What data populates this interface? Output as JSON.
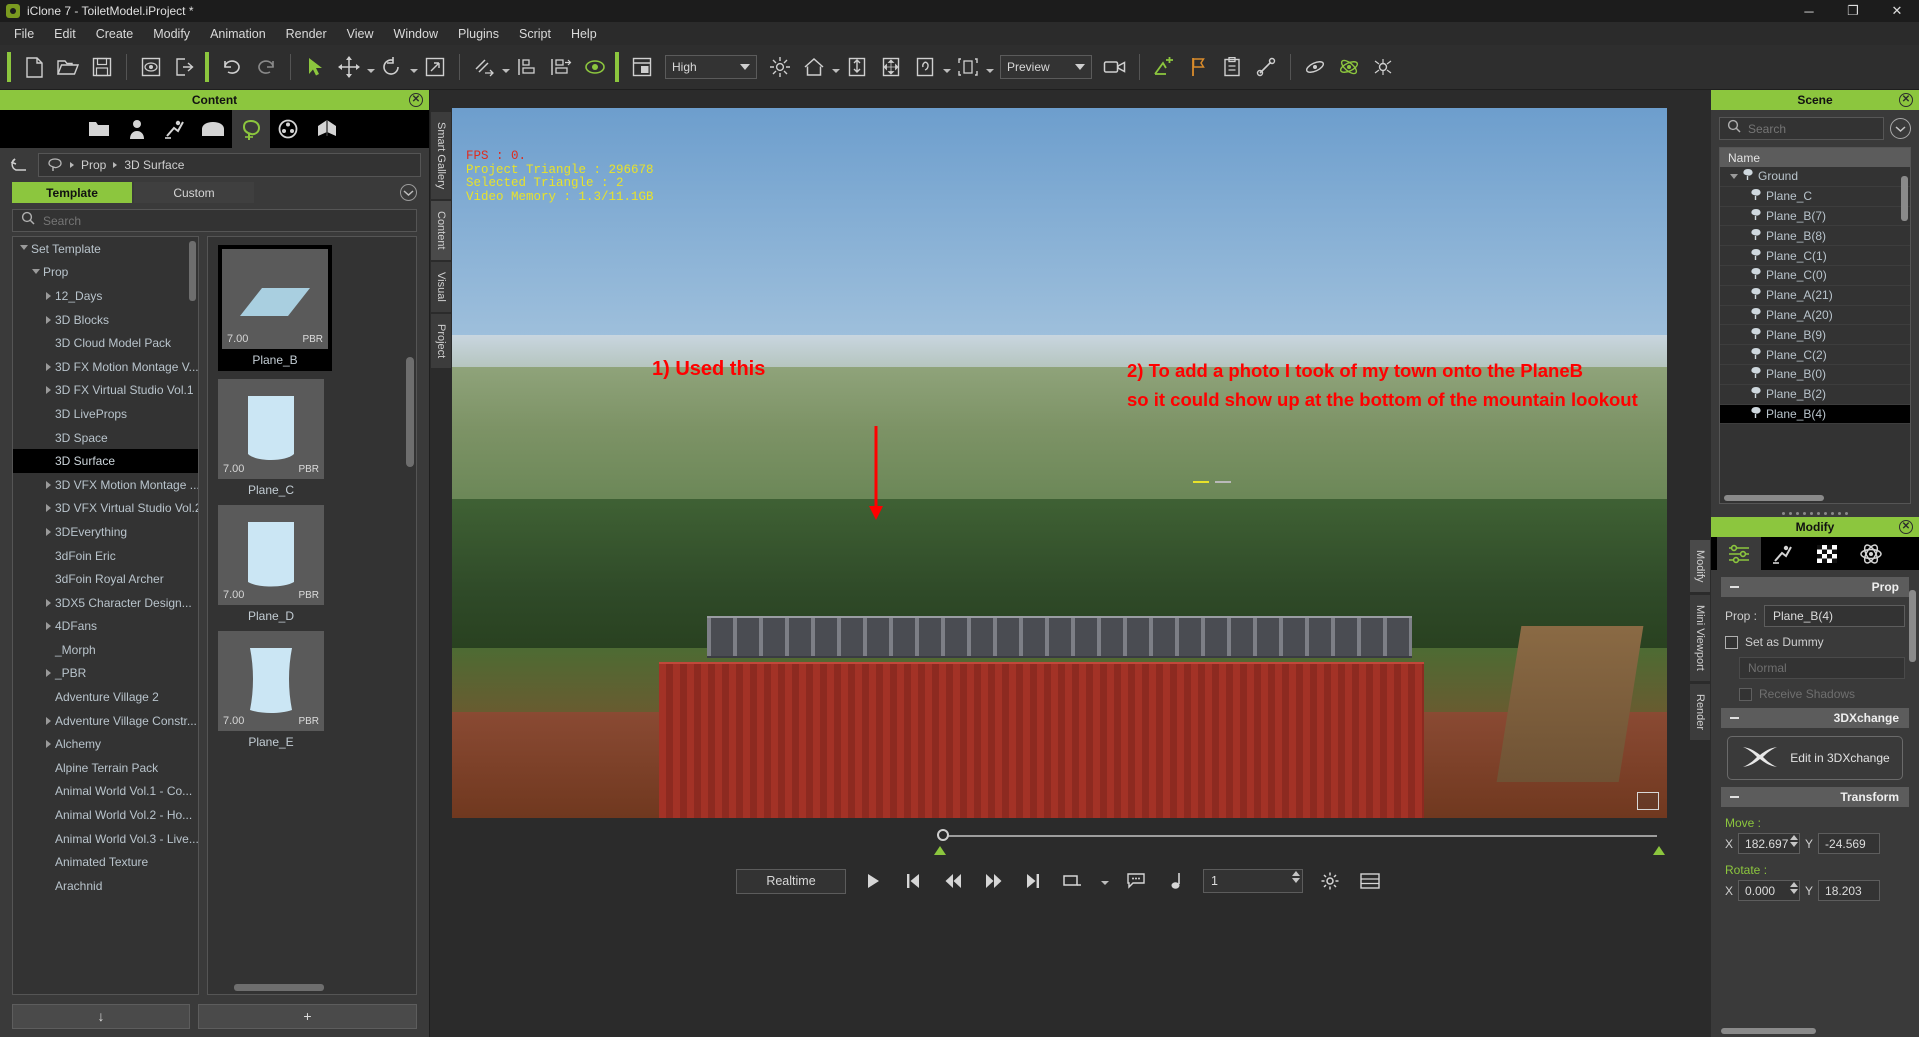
{
  "window": {
    "title": "iClone 7 - ToiletModel.iProject *",
    "minimize": "─",
    "maximize": "❐",
    "close": "✕"
  },
  "menubar": {
    "items": [
      "File",
      "Edit",
      "Create",
      "Modify",
      "Animation",
      "Render",
      "View",
      "Window",
      "Plugins",
      "Script",
      "Help"
    ]
  },
  "toolbar": {
    "quality_value": "High",
    "preview_value": "Preview",
    "icons": [
      "new-icon",
      "open-icon",
      "save-icon",
      "preview-window-icon",
      "export-icon",
      "undo-icon",
      "redo-icon",
      "select-arrow-icon",
      "move-icon",
      "rotate-icon",
      "scale-icon",
      "link-icon",
      "align-icon",
      "align-distribute-icon",
      "eye-icon",
      "layout-icon",
      "light-icon",
      "home-icon",
      "ground-icon",
      "center-icon",
      "camera-view-icon",
      "bounding-box-icon",
      "camera-icon",
      "light-add-icon",
      "flag-icon",
      "clipboard-icon",
      "magnet-icon",
      "physics-icon",
      "particle-icon",
      "spider-icon"
    ]
  },
  "content_panel": {
    "title": "Content",
    "library_tabs": [
      "folder-icon",
      "character-icon",
      "motion-icon",
      "stage-icon",
      "prop-icon",
      "media-icon",
      "element-icon"
    ],
    "breadcrumb": {
      "root_icon": "library-icon",
      "items": [
        "Prop",
        "3D Surface"
      ]
    },
    "tabs": [
      {
        "label": "Template",
        "active": true
      },
      {
        "label": "Custom",
        "active": false
      }
    ],
    "search_placeholder": "Search",
    "search_value": "",
    "tree": [
      {
        "label": "Set Template",
        "depth": 0,
        "state": "open"
      },
      {
        "label": "Prop",
        "depth": 1,
        "state": "open"
      },
      {
        "label": "12_Days",
        "depth": 2,
        "state": "closed"
      },
      {
        "label": "3D Blocks",
        "depth": 2,
        "state": "closed"
      },
      {
        "label": "3D Cloud Model Pack",
        "depth": 2,
        "state": "leaf"
      },
      {
        "label": "3D FX Motion Montage V...",
        "depth": 2,
        "state": "closed"
      },
      {
        "label": "3D FX Virtual Studio Vol.1",
        "depth": 2,
        "state": "closed"
      },
      {
        "label": "3D LiveProps",
        "depth": 2,
        "state": "leaf"
      },
      {
        "label": "3D Space",
        "depth": 2,
        "state": "leaf"
      },
      {
        "label": "3D Surface",
        "depth": 2,
        "state": "leaf",
        "selected": true
      },
      {
        "label": "3D VFX Motion Montage ...",
        "depth": 2,
        "state": "closed"
      },
      {
        "label": "3D VFX Virtual Studio Vol.2",
        "depth": 2,
        "state": "closed"
      },
      {
        "label": "3DEverything",
        "depth": 2,
        "state": "closed"
      },
      {
        "label": "3dFoin Eric",
        "depth": 2,
        "state": "leaf"
      },
      {
        "label": "3dFoin Royal Archer",
        "depth": 2,
        "state": "leaf"
      },
      {
        "label": "3DX5 Character Design...",
        "depth": 2,
        "state": "closed"
      },
      {
        "label": "4DFans",
        "depth": 2,
        "state": "closed"
      },
      {
        "label": "_Morph",
        "depth": 2,
        "state": "leaf"
      },
      {
        "label": "_PBR",
        "depth": 2,
        "state": "closed"
      },
      {
        "label": "Adventure Village 2",
        "depth": 2,
        "state": "leaf"
      },
      {
        "label": "Adventure Village Constr...",
        "depth": 2,
        "state": "closed"
      },
      {
        "label": "Alchemy",
        "depth": 2,
        "state": "closed"
      },
      {
        "label": "Alpine Terrain Pack",
        "depth": 2,
        "state": "leaf"
      },
      {
        "label": "Animal World Vol.1 - Co...",
        "depth": 2,
        "state": "leaf"
      },
      {
        "label": "Animal World Vol.2 - Ho...",
        "depth": 2,
        "state": "leaf"
      },
      {
        "label": "Animal World Vol.3 - Live...",
        "depth": 2,
        "state": "leaf"
      },
      {
        "label": "Animated Texture",
        "depth": 2,
        "state": "leaf"
      },
      {
        "label": "Arachnid",
        "depth": 2,
        "state": "leaf"
      }
    ],
    "thumbnails": [
      {
        "name": "Plane_B",
        "duration": "7.00",
        "badge": "PBR",
        "selected": true,
        "shape": "flat"
      },
      {
        "name": "Plane_C",
        "duration": "7.00",
        "badge": "PBR",
        "selected": false,
        "shape": "curve1"
      },
      {
        "name": "Plane_D",
        "duration": "7.00",
        "badge": "PBR",
        "selected": false,
        "shape": "curve2"
      },
      {
        "name": "Plane_E",
        "duration": "7.00",
        "badge": "PBR",
        "selected": false,
        "shape": "curve3"
      }
    ],
    "footer": {
      "download_label": "↓",
      "add_label": "+"
    }
  },
  "side_tabs_left": [
    "Smart Gallery",
    "Content",
    "Visual",
    "Project"
  ],
  "side_tabs_right": [
    "Modify",
    "Mini Viewport",
    "Render"
  ],
  "viewport": {
    "stats": {
      "fps": "FPS : 0.",
      "project_triangle": "Project Triangle : 296678",
      "selected_triangle": "Selected Triangle : 2",
      "video_memory": "Video Memory : 1.3/11.1GB"
    },
    "annotation_1": "1) Used this",
    "annotation_2_line1": "2) To add a photo I took of my town onto the PlaneB",
    "annotation_2_line2": "so it could show up at the bottom of the mountain lookout"
  },
  "timeline": {
    "realtime_label": "Realtime",
    "frame_value": "1",
    "buttons": [
      "play-button",
      "jump-start-button",
      "rewind-button",
      "fast-forward-button",
      "jump-end-button",
      "range-button",
      "comment-button",
      "note-button",
      "settings-button",
      "timeline-button"
    ]
  },
  "scene_panel": {
    "title": "Scene",
    "search_placeholder": "Search",
    "search_value": "",
    "column_header": "Name",
    "items": [
      {
        "label": "Ground",
        "depth": 0,
        "expandable": true
      },
      {
        "label": "Plane_C",
        "depth": 1
      },
      {
        "label": "Plane_B(7)",
        "depth": 1
      },
      {
        "label": "Plane_B(8)",
        "depth": 1
      },
      {
        "label": "Plane_C(1)",
        "depth": 1
      },
      {
        "label": "Plane_C(0)",
        "depth": 1
      },
      {
        "label": "Plane_A(21)",
        "depth": 1
      },
      {
        "label": "Plane_A(20)",
        "depth": 1
      },
      {
        "label": "Plane_B(9)",
        "depth": 1
      },
      {
        "label": "Plane_C(2)",
        "depth": 1
      },
      {
        "label": "Plane_B(0)",
        "depth": 1
      },
      {
        "label": "Plane_B(2)",
        "depth": 1
      },
      {
        "label": "Plane_B(4)",
        "depth": 1,
        "selected": true
      }
    ]
  },
  "modify_panel": {
    "title": "Modify",
    "tabs": [
      "attribute-icon",
      "motion-icon",
      "material-icon",
      "physics-icon"
    ],
    "sections": {
      "prop": {
        "header": "Prop",
        "prop_label": "Prop :",
        "prop_value": "Plane_B(4)",
        "set_as_dummy_label": "Set as Dummy",
        "set_as_dummy_checked": false,
        "normal_value": "Normal",
        "receive_shadows_label": "Receive Shadows",
        "receive_shadows_checked": false
      },
      "3dxchange": {
        "header": "3DXchange",
        "edit_button_label": "Edit in 3DXchange"
      },
      "transform": {
        "header": "Transform",
        "move_label": "Move :",
        "move_x_label": "X",
        "move_x": "182.697",
        "move_y_label": "Y",
        "move_y": "-24.569",
        "rotate_label": "Rotate :",
        "rotate_x_label": "X",
        "rotate_x": "0.000",
        "rotate_y_label": "Y",
        "rotate_y": "18.203"
      }
    }
  },
  "colors": {
    "accent_green": "#8cc63e",
    "panel_bg": "#3a3a3a",
    "annotation_red": "#ff0000",
    "stats_yellow": "#e8e22a"
  }
}
